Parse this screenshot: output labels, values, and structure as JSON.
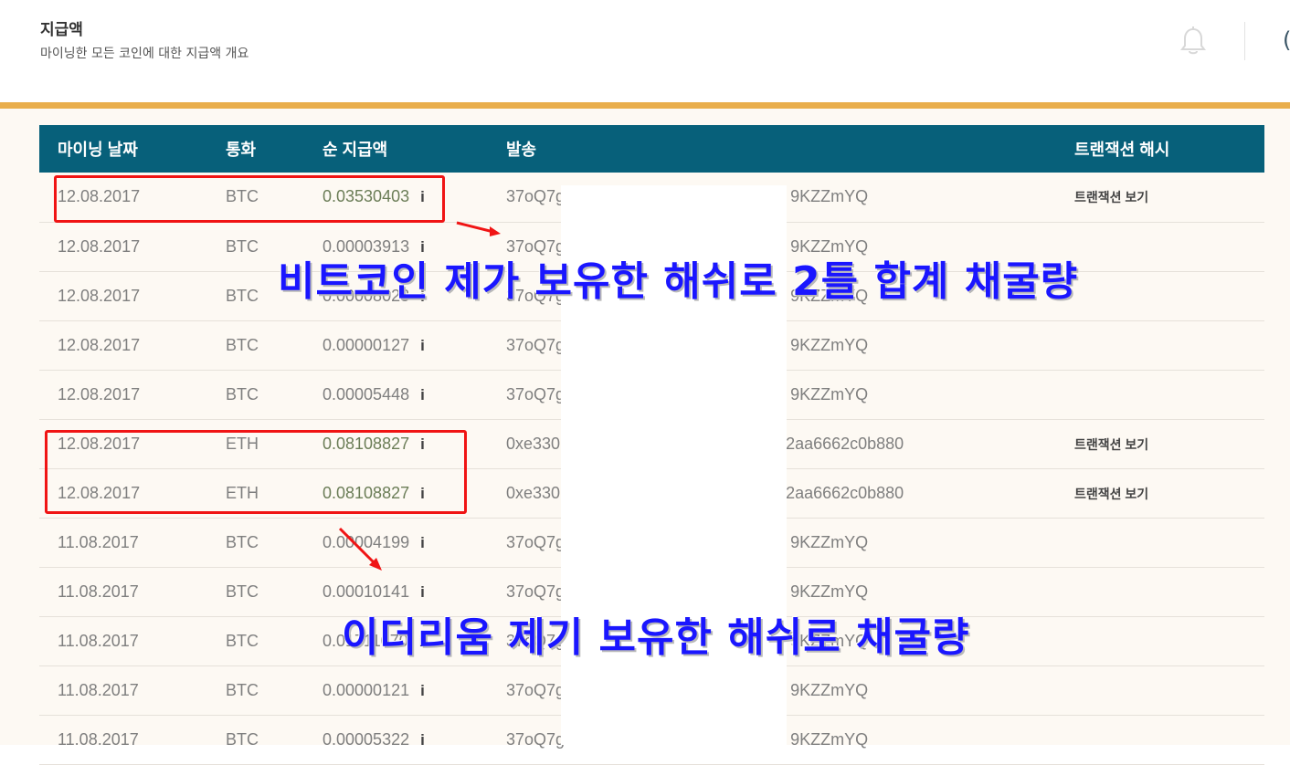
{
  "header": {
    "title": "지급액",
    "subtitle": "마이닝한 모든 코인에 대한 지급액 개요",
    "partial_glyph": "("
  },
  "table": {
    "columns": [
      "마이닝 날짜",
      "통화",
      "순 지급액",
      "발송",
      "트랜잭션 해시"
    ],
    "rows": [
      {
        "date": "12.08.2017",
        "currency": "BTC",
        "amount": "0.03530403",
        "sent_prefix": "37oQ7g",
        "sent_suffix": "9KZZmYQ",
        "tx": "트랜잭션 보기"
      },
      {
        "date": "12.08.2017",
        "currency": "BTC",
        "amount": "0.00003913",
        "sent_prefix": "37oQ7g",
        "sent_suffix": "9KZZmYQ",
        "tx": ""
      },
      {
        "date": "12.08.2017",
        "currency": "BTC",
        "amount": "0.00008023",
        "sent_prefix": "37oQ7g",
        "sent_suffix": "9KZZmYQ",
        "tx": ""
      },
      {
        "date": "12.08.2017",
        "currency": "BTC",
        "amount": "0.00000127",
        "sent_prefix": "37oQ7g",
        "sent_suffix": "9KZZmYQ",
        "tx": ""
      },
      {
        "date": "12.08.2017",
        "currency": "BTC",
        "amount": "0.00005448",
        "sent_prefix": "37oQ7g",
        "sent_suffix": "9KZZmYQ",
        "tx": ""
      },
      {
        "date": "12.08.2017",
        "currency": "ETH",
        "amount": "0.08108827",
        "sent_prefix": "0xe330",
        "sent_suffix": "2aa6662c0b880",
        "tx": "트랜잭션 보기"
      },
      {
        "date": "12.08.2017",
        "currency": "ETH",
        "amount": "0.08108827",
        "sent_prefix": "0xe330",
        "sent_suffix": "2aa6662c0b880",
        "tx": "트랜잭션 보기"
      },
      {
        "date": "11.08.2017",
        "currency": "BTC",
        "amount": "0.00004199",
        "sent_prefix": "37oQ7g",
        "sent_suffix": "9KZZmYQ",
        "tx": ""
      },
      {
        "date": "11.08.2017",
        "currency": "BTC",
        "amount": "0.00010141",
        "sent_prefix": "37oQ7g",
        "sent_suffix": "9KZZmYQ",
        "tx": ""
      },
      {
        "date": "11.08.2017",
        "currency": "BTC",
        "amount": "0.01711070",
        "sent_prefix": "37oQ7g",
        "sent_suffix": "9KZZmYQ",
        "tx": ""
      },
      {
        "date": "11.08.2017",
        "currency": "BTC",
        "amount": "0.00000121",
        "sent_prefix": "37oQ7g",
        "sent_suffix": "9KZZmYQ",
        "tx": ""
      },
      {
        "date": "11.08.2017",
        "currency": "BTC",
        "amount": "0.00005322",
        "sent_prefix": "37oQ7g",
        "sent_suffix": "9KZZmYQ",
        "tx": ""
      }
    ],
    "info_glyph": "i"
  },
  "annotations": {
    "btc_note": "비트코인 제가 보유한 해쉬로 2틀 합계 채굴량",
    "eth_note": "이더리움 제기 보유한 해쉬로 채굴량"
  },
  "colors": {
    "header_bar": "#07607a",
    "gold_bar": "#e9ae4c",
    "row_bg": "#fdf9f3",
    "annotation_box": "#f01414",
    "annotation_text": "#1a16ff"
  }
}
